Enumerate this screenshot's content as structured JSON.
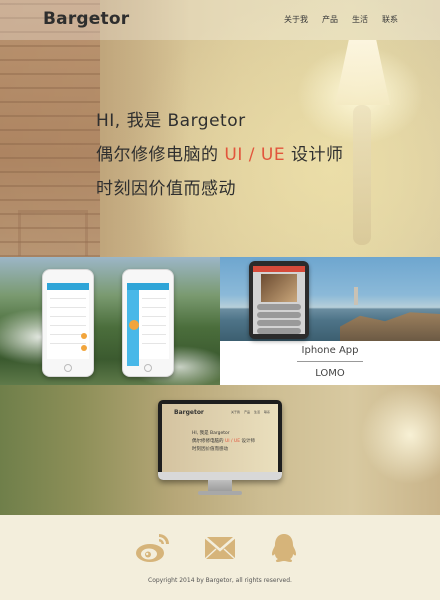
{
  "nav": {
    "logo": "Bargetor",
    "items": [
      "关于我",
      "产品",
      "生活",
      "联系"
    ]
  },
  "hero": {
    "line1_prefix": "HI, 我是 ",
    "line1_name": "Bargetor",
    "line2_prefix": "偶尔修修电脑的 ",
    "line2_highlight": "UI / UE",
    "line2_suffix": " 设计师",
    "line3": "时刻因价值而感动"
  },
  "portfolio": {
    "right_caption_title": "Iphone App",
    "right_caption_sub": "LOMO"
  },
  "monitor_screen": {
    "logo": "Bargetor",
    "menu": [
      "关于我",
      "产品",
      "生活",
      "联系"
    ],
    "line1": "HI, 我是 Bargetor",
    "line2_prefix": "偶尔修修电脑的 ",
    "line2_highlight": "UI / UE",
    "line2_suffix": " 设计师",
    "line3": "时刻因价值而感动"
  },
  "footer": {
    "icons": [
      "weibo-icon",
      "mail-icon",
      "qq-icon"
    ],
    "copyright": "Copyright 2014 by Bargetor, all rights reserved."
  },
  "colors": {
    "accent": "#e2553c",
    "icon": "#d6b47a",
    "footer_bg": "#f3eedc"
  }
}
